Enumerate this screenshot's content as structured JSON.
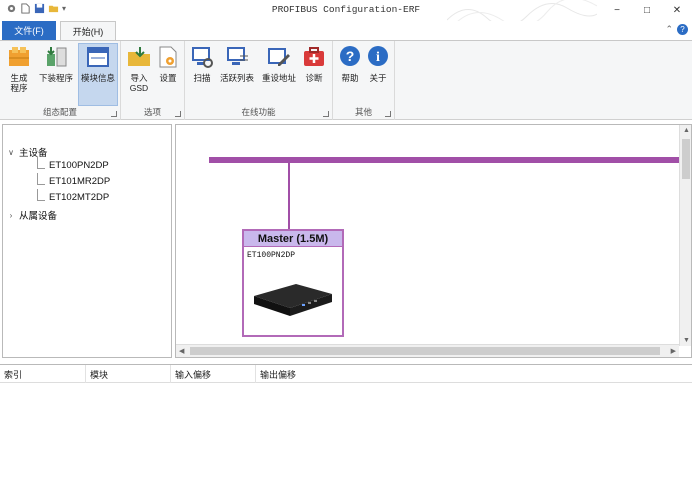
{
  "window": {
    "title": "PROFIBUS Configuration-ERF",
    "minimize": "−",
    "maximize": "□",
    "close": "✕"
  },
  "tabs": {
    "file": "文件(F)",
    "start": "开始(H)"
  },
  "ribbon_controls": {
    "collapse": "⌃",
    "help": "?"
  },
  "ribbon": {
    "groups": {
      "config": {
        "label": "组态配置",
        "buttons": [
          {
            "label": "生成\n程序",
            "icon": "generate-program-icon"
          },
          {
            "label": "下装程序",
            "icon": "download-program-icon"
          },
          {
            "label": "模块信息",
            "icon": "module-info-icon",
            "selected": true
          }
        ]
      },
      "options": {
        "label": "选项",
        "buttons": [
          {
            "label": "导入\nGSD",
            "icon": "import-gsd-icon"
          },
          {
            "label": "设置",
            "icon": "settings-icon"
          }
        ]
      },
      "online": {
        "label": "在线功能",
        "buttons": [
          {
            "label": "扫描",
            "icon": "scan-icon"
          },
          {
            "label": "活跃列表",
            "icon": "active-list-icon"
          },
          {
            "label": "重设地址",
            "icon": "reset-address-icon"
          },
          {
            "label": "诊断",
            "icon": "diagnose-icon"
          }
        ]
      },
      "other": {
        "label": "其他",
        "buttons": [
          {
            "label": "帮助",
            "icon": "help-icon"
          },
          {
            "label": "关于",
            "icon": "about-icon"
          }
        ]
      }
    }
  },
  "tree": {
    "master": {
      "label": "主设备",
      "expanded": true,
      "children": [
        "ET100PN2DP",
        "ET101MR2DP",
        "ET102MT2DP"
      ]
    },
    "slave": {
      "label": "从属设备",
      "expanded": false
    }
  },
  "canvas": {
    "master_title": "Master (1.5M)",
    "master_device": "ET100PN2DP",
    "bus_color": "#a14fa7"
  },
  "table": {
    "columns": [
      "索引",
      "模块",
      "输入偏移",
      "输出偏移"
    ]
  },
  "colors": {
    "accent": "#2b6cc4",
    "selected": "#c5d7ee",
    "header_fill": "#c9b8ec"
  }
}
